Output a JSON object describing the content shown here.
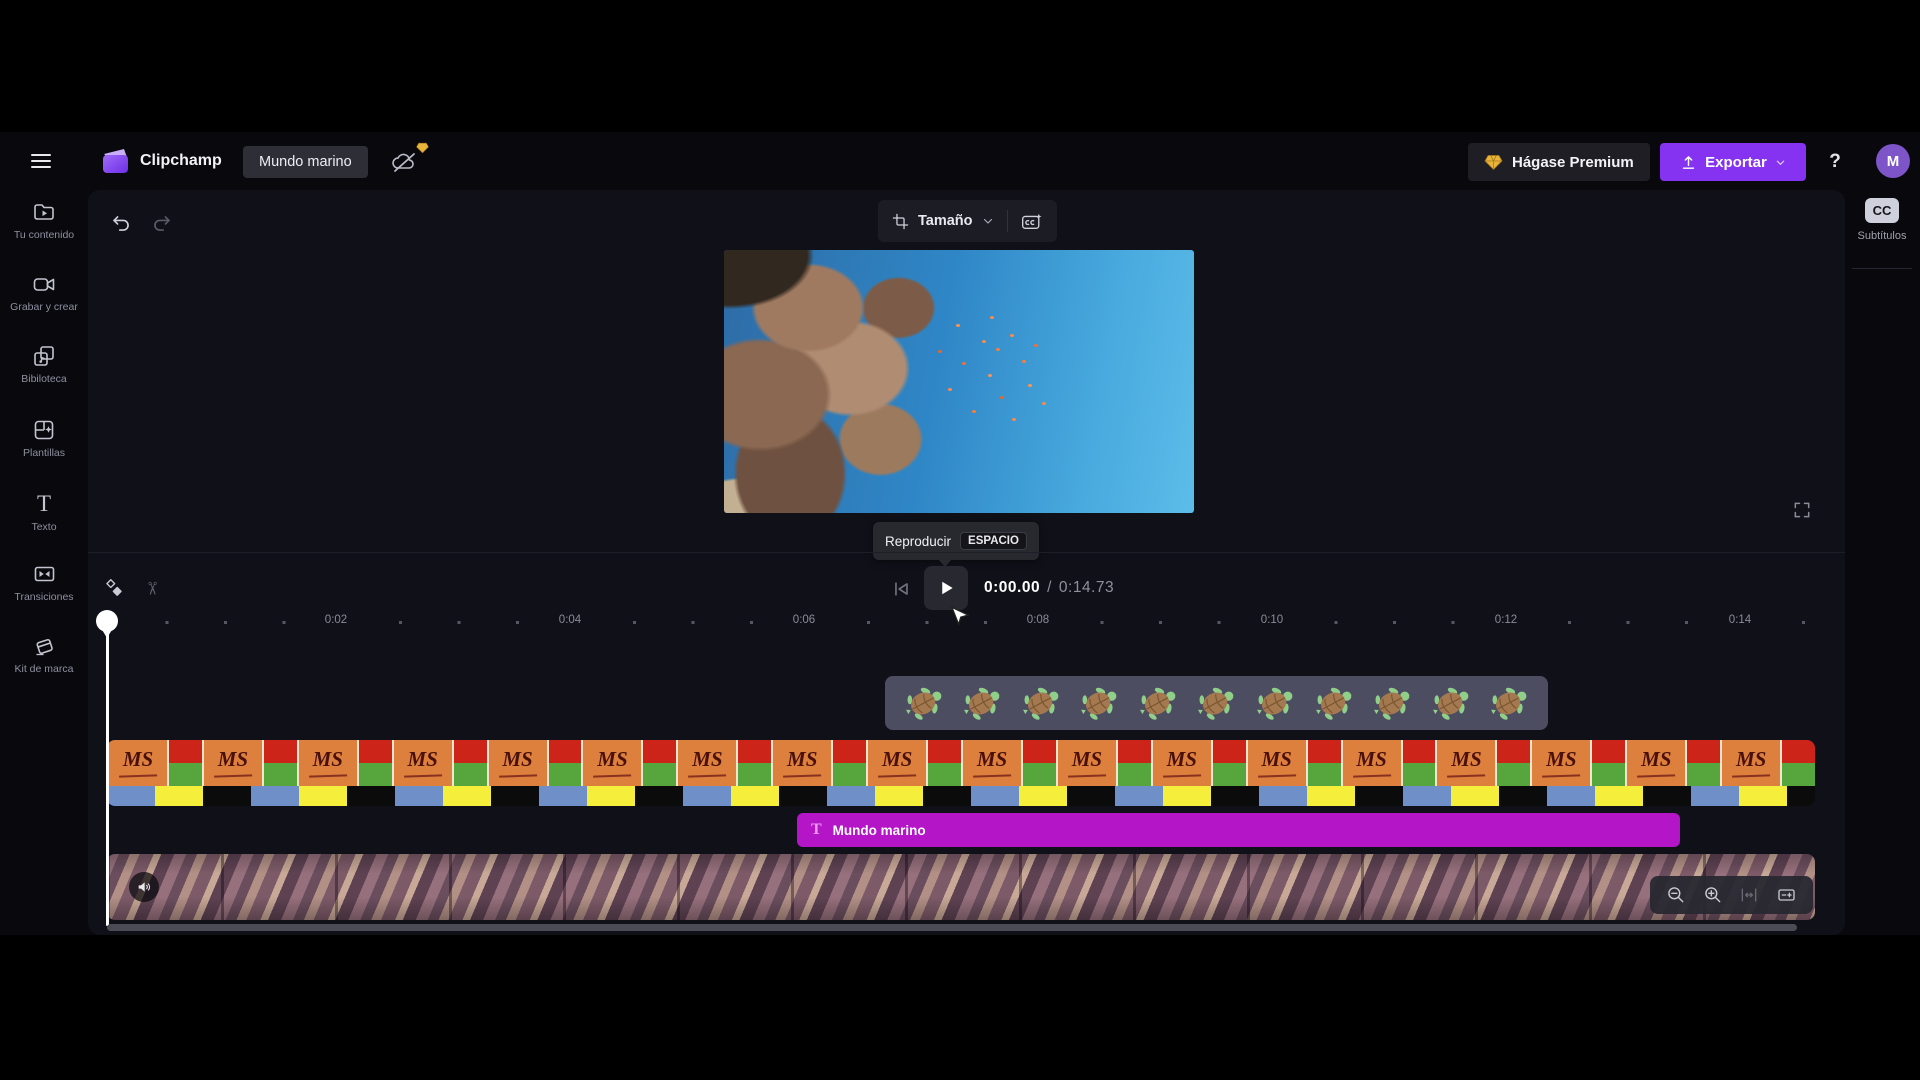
{
  "header": {
    "app_name": "Clipchamp",
    "project_title": "Mundo marino",
    "premium_label": "Hágase Premium",
    "export_label": "Exportar",
    "help_label": "?",
    "avatar_initial": "M"
  },
  "sidebar": {
    "items": [
      {
        "label": "Tu contenido"
      },
      {
        "label": "Grabar y crear"
      },
      {
        "label": "Bibiloteca"
      },
      {
        "label": "Plantillas"
      },
      {
        "label": "Texto"
      },
      {
        "label": "Transiciones"
      },
      {
        "label": "Kit de marca"
      }
    ]
  },
  "captions_panel": {
    "icon_label": "CC",
    "label": "Subtítulos"
  },
  "preview": {
    "size_label": "Tamaño",
    "tooltip_action": "Reproducir",
    "tooltip_shortcut": "ESPACIO"
  },
  "transport": {
    "current_time": "0:00.00",
    "separator": "/",
    "total_time": "0:14.73"
  },
  "timeline": {
    "ruler_labels": [
      "0:02",
      "0:04",
      "0:06",
      "0:08",
      "0:10",
      "0:12",
      "0:14"
    ],
    "sticker_clip": {
      "count": 11
    },
    "pattern_clip": {
      "count": 18,
      "logo": "MS"
    },
    "text_clip": {
      "label": "Mundo marino"
    }
  },
  "glyphs": {
    "text_icon": "T",
    "scissors": "✂"
  },
  "colors": {
    "accent_purple": "#8633f1",
    "text_clip_magenta": "#b315c7",
    "premium_gold": "#e8b43a",
    "panel_bg": "#101019"
  }
}
